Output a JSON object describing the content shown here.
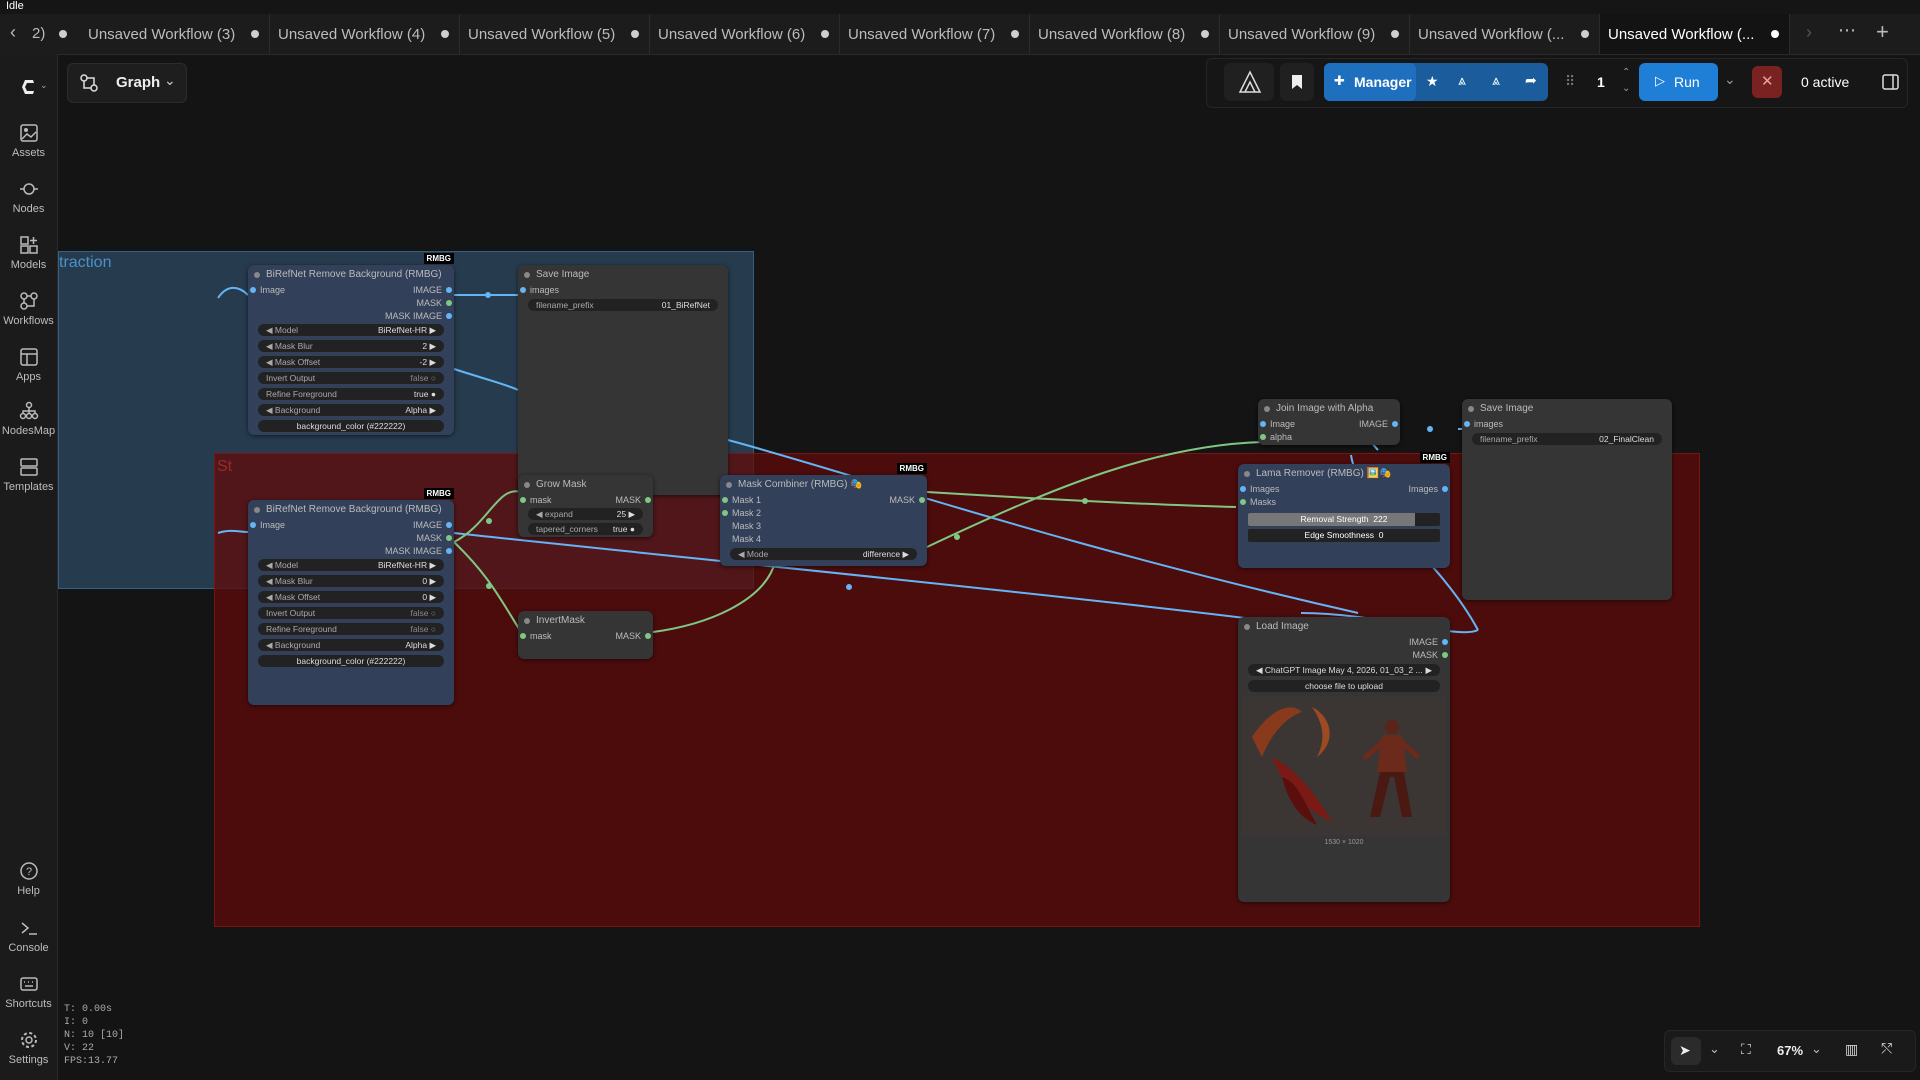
{
  "app": {
    "status": "Idle"
  },
  "tabs": {
    "overflow_label": "2)",
    "items": [
      {
        "label": "Unsaved Workflow (3)"
      },
      {
        "label": "Unsaved Workflow (4)"
      },
      {
        "label": "Unsaved Workflow (5)"
      },
      {
        "label": "Unsaved Workflow (6)"
      },
      {
        "label": "Unsaved Workflow (7)"
      },
      {
        "label": "Unsaved Workflow (8)"
      },
      {
        "label": "Unsaved Workflow (9)"
      },
      {
        "label": "Unsaved Workflow (..."
      },
      {
        "label": "Unsaved Workflow (..."
      }
    ]
  },
  "sidebar": {
    "items": [
      {
        "label": "Assets"
      },
      {
        "label": "Nodes"
      },
      {
        "label": "Models"
      },
      {
        "label": "Workflows"
      },
      {
        "label": "Apps"
      },
      {
        "label": "NodesMap"
      },
      {
        "label": "Templates"
      },
      {
        "label": "Help"
      },
      {
        "label": "Console"
      },
      {
        "label": "Shortcuts"
      },
      {
        "label": "Settings"
      }
    ]
  },
  "toolbar": {
    "graph_label": "Graph",
    "manager_label": "Manager",
    "batch_count": "1",
    "run_label": "Run",
    "active_label": "0 active"
  },
  "groups": {
    "blue_title": "traction",
    "red_title": "St"
  },
  "nodes": {
    "birefnet1": {
      "title": "BiRefNet Remove Background (RMBG)",
      "badge": "RMBG",
      "input": "Image",
      "outputs": [
        "IMAGE",
        "MASK",
        "MASK IMAGE"
      ],
      "widgets": [
        {
          "label": "Model",
          "value": "BiRefNet-HR"
        },
        {
          "label": "Mask Blur",
          "value": "2"
        },
        {
          "label": "Mask Offset",
          "value": "-2"
        },
        {
          "label": "Invert Output",
          "value": "false"
        },
        {
          "label": "Refine Foreground",
          "value": "true"
        },
        {
          "label": "Background",
          "value": "Alpha"
        }
      ],
      "button": "background_color (#222222)"
    },
    "birefnet2": {
      "title": "BiRefNet Remove Background (RMBG)",
      "badge": "RMBG",
      "input": "Image",
      "outputs": [
        "IMAGE",
        "MASK",
        "MASK IMAGE"
      ],
      "widgets": [
        {
          "label": "Model",
          "value": "BiRefNet-HR"
        },
        {
          "label": "Mask Blur",
          "value": "0"
        },
        {
          "label": "Mask Offset",
          "value": "0"
        },
        {
          "label": "Invert Output",
          "value": "false"
        },
        {
          "label": "Refine Foreground",
          "value": "false"
        },
        {
          "label": "Background",
          "value": "Alpha"
        }
      ],
      "button": "background_color (#222222)"
    },
    "save1": {
      "title": "Save Image",
      "input": "images",
      "widget_label": "filename_prefix",
      "widget_value": "01_BiRefNet"
    },
    "grow": {
      "title": "Grow Mask",
      "input": "mask",
      "output": "MASK",
      "widgets": [
        {
          "label": "expand",
          "value": "25"
        },
        {
          "label": "tapered_corners",
          "value": "true"
        }
      ]
    },
    "invert": {
      "title": "InvertMask",
      "input": "mask",
      "output": "MASK"
    },
    "combiner": {
      "title": "Mask Combiner (RMBG) 🎭",
      "badge": "RMBG",
      "inputs": [
        "Mask 1",
        "Mask 2",
        "Mask 3",
        "Mask 4"
      ],
      "output": "MASK",
      "mode_label": "Mode",
      "mode_value": "difference"
    },
    "join": {
      "title": "Join Image with Alpha",
      "inputs": [
        "Image",
        "alpha"
      ],
      "output": "IMAGE"
    },
    "lama": {
      "title": "Lama Remover (RMBG) 🖼️🎭",
      "badge": "RMBG",
      "inputs": [
        "Images",
        "Masks"
      ],
      "output": "Images",
      "removal_label": "Removal Strength",
      "removal_value": "222",
      "edge_label": "Edge Smoothness",
      "edge_value": "0"
    },
    "save2": {
      "title": "Save Image",
      "input": "images",
      "widget_label": "filename_prefix",
      "widget_value": "02_FinalClean"
    },
    "load": {
      "title": "Load Image",
      "outputs": [
        "IMAGE",
        "MASK"
      ],
      "file_value": "ChatGPT Image May 4, 2026, 01_03_2 ...",
      "upload_label": "choose file to upload",
      "dims": "1530 × 1020"
    }
  },
  "perf": {
    "t": "T: 0.00s",
    "i": "I: 0",
    "n": "N: 10 [10]",
    "v": "V: 22",
    "fps": "FPS:13.77"
  },
  "zoom": {
    "value": "67%"
  },
  "colors": {
    "accent": "#1f7fd6",
    "image_link": "#64b5f6",
    "mask_link": "#81c784",
    "group_blue": "#345c7e",
    "group_red": "#600a0a"
  }
}
